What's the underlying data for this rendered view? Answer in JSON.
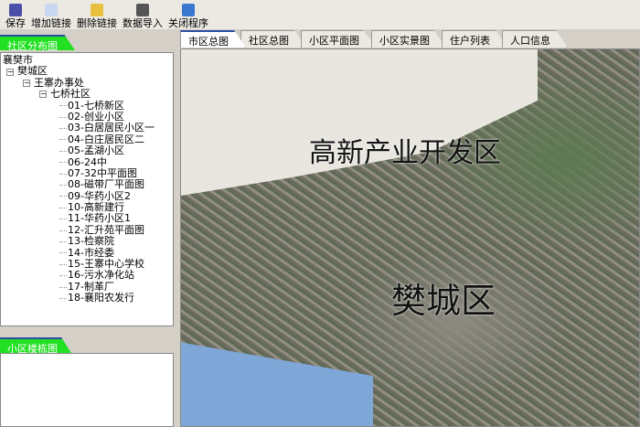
{
  "toolbar": [
    {
      "label": "保存",
      "icon": "save-icon",
      "color": "#4a4fa8"
    },
    {
      "label": "增加链接",
      "icon": "new-doc-icon",
      "color": "#c8d8f0"
    },
    {
      "label": "删除链接",
      "icon": "folder-icon",
      "color": "#e8c040"
    },
    {
      "label": "数据导入",
      "icon": "import-icon",
      "color": "#555555"
    },
    {
      "label": "关闭程序",
      "icon": "exit-icon",
      "color": "#3a78d0"
    }
  ],
  "left": {
    "top_tab": "社区分布图",
    "bottom_tab": "小区楼栋图",
    "tree": {
      "root": "襄樊市",
      "district": "樊城区",
      "office": "王寨办事处",
      "community": "七桥社区",
      "items": [
        "01-七桥新区",
        "02-创业小区",
        "03-白居居民小区一",
        "04-白庄居民区二",
        "05-孟湖小区",
        "06-24中",
        "07-32中平面图",
        "08-磁带厂平面图",
        "09-华药小区2",
        "10-高新建行",
        "11-华药小区1",
        "12-汇升苑平面图",
        "13-检察院",
        "14-市经委",
        "15-王寨中心学校",
        "16-污水净化站",
        "17-制革厂",
        "18-襄阳农发行"
      ]
    }
  },
  "tabs": [
    "市区总图",
    "社区总图",
    "小区平面图",
    "小区实景图",
    "住户列表",
    "人口信息"
  ],
  "map": {
    "label1": "高新产业开发区",
    "label2": "樊城区"
  }
}
